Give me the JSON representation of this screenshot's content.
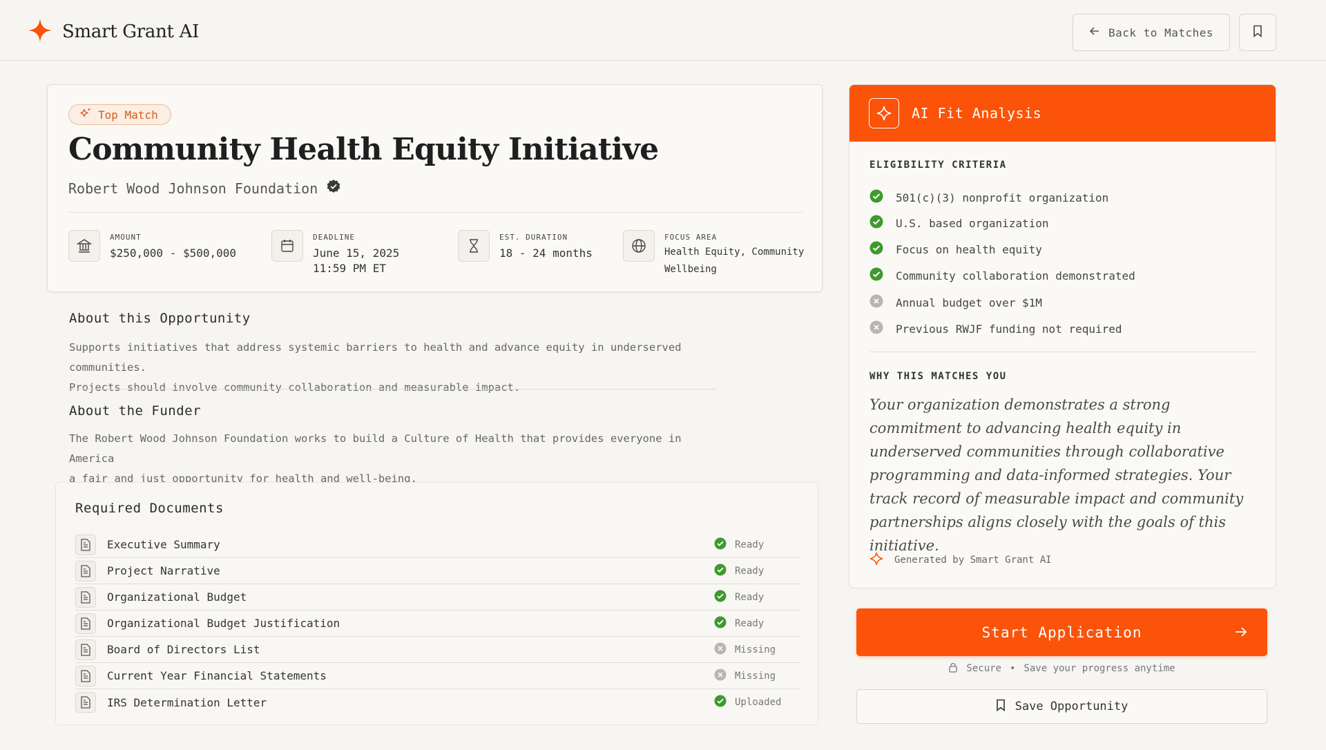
{
  "header": {
    "brand_name": "Smart Grant AI",
    "back_label": "Back to Matches"
  },
  "grant": {
    "badge": "Top Match",
    "title": "Community Health Equity Initiative",
    "funder": "Robert Wood Johnson Foundation",
    "meta": {
      "amount_label": "AMOUNT",
      "amount_value": "$250,000 - $500,000",
      "deadline_label": "DEADLINE",
      "deadline_value_1": "June 15, 2025",
      "deadline_value_2": "11:59 PM ET",
      "duration_label": "EST. DURATION",
      "duration_value": "18 - 24 months",
      "focus_label": "FOCUS AREA",
      "focus_value_1": "Health Equity, Community",
      "focus_value_2": "Wellbeing"
    }
  },
  "about_opportunity": {
    "title": "About this Opportunity",
    "line1": "Supports initiatives that address systemic barriers to health and advance equity in underserved communities.",
    "line2": "Projects should involve community collaboration and measurable impact."
  },
  "about_funder": {
    "title": "About the Funder",
    "line1": "The Robert Wood Johnson Foundation works to build a Culture of Health that provides everyone in America",
    "line2": "a fair and just opportunity for health and well-being."
  },
  "documents": {
    "title": "Required Documents",
    "items": [
      {
        "name": "Executive Summary",
        "status": "Ready",
        "state": "ok"
      },
      {
        "name": "Project Narrative",
        "status": "Ready",
        "state": "ok"
      },
      {
        "name": "Organizational Budget",
        "status": "Ready",
        "state": "ok"
      },
      {
        "name": "Organizational Budget Justification",
        "status": "Ready",
        "state": "ok"
      },
      {
        "name": "Board of Directors List",
        "status": "Missing",
        "state": "missing"
      },
      {
        "name": "Current Year Financial Statements",
        "status": "Missing",
        "state": "missing"
      },
      {
        "name": "IRS Determination Letter",
        "status": "Uploaded",
        "state": "ok"
      }
    ]
  },
  "ai_panel": {
    "title": "AI Fit Analysis",
    "eligibility_title": "ELIGIBILITY CRITERIA",
    "criteria": [
      {
        "text": "501(c)(3) nonprofit organization",
        "met": true
      },
      {
        "text": "U.S. based organization",
        "met": true
      },
      {
        "text": "Focus on health equity",
        "met": true
      },
      {
        "text": "Community collaboration demonstrated",
        "met": true
      },
      {
        "text": "Annual budget over $1M",
        "met": false
      },
      {
        "text": "Previous RWJF funding not required",
        "met": false
      }
    ],
    "why_title": "WHY THIS MATCHES YOU",
    "why_text": "Your organization demonstrates a strong commitment to advancing health equity in underserved communities through collaborative programming and data-informed strategies. Your track record of measurable impact and community partnerships aligns closely with the goals of this initiative.",
    "generated_by": "Generated by Smart Grant AI"
  },
  "actions": {
    "start_label": "Start Application",
    "secure_label": "Secure",
    "secure_sep": "•",
    "secure_note": "Save your progress anytime",
    "save_label": "Save Opportunity"
  },
  "colors": {
    "accent": "#fb5309",
    "success": "#3f9a2e",
    "muted": "#b9b6b0"
  }
}
